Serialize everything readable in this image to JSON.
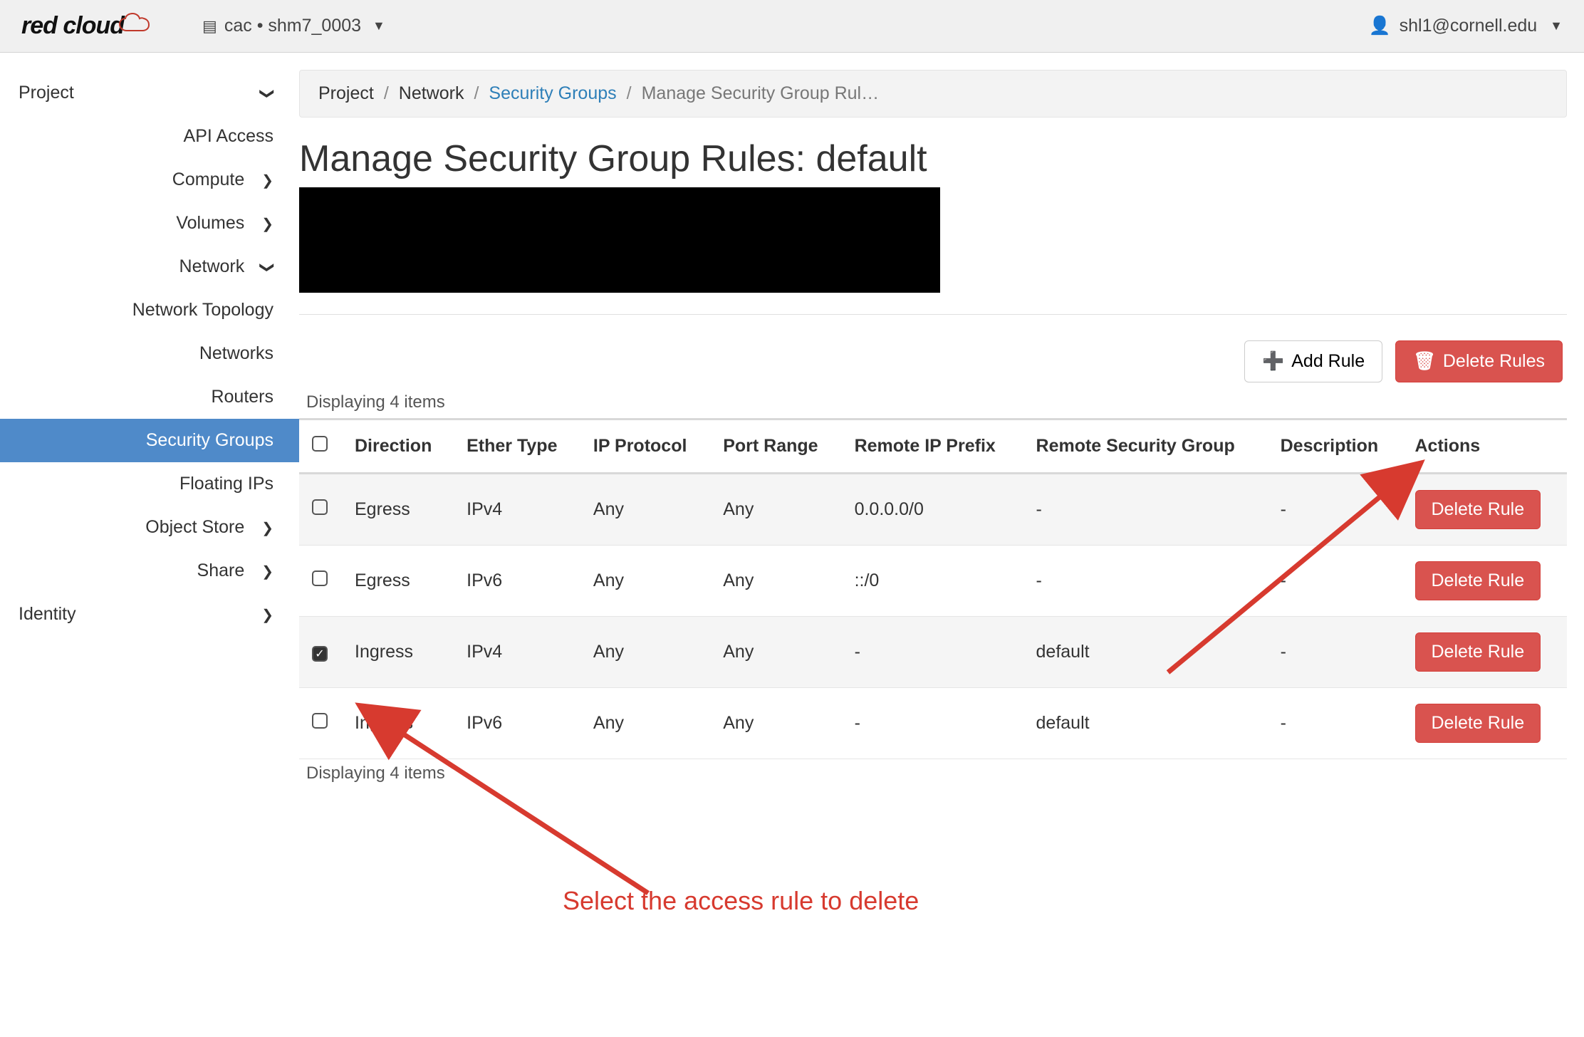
{
  "topbar": {
    "logo_left": "red",
    "logo_right": "cloud",
    "project_switcher": "cac • shm7_0003",
    "user": "shl1@cornell.edu"
  },
  "sidebar": {
    "project": "Project",
    "api_access": "API Access",
    "compute": "Compute",
    "volumes": "Volumes",
    "network": "Network",
    "network_topology": "Network Topology",
    "networks": "Networks",
    "routers": "Routers",
    "security_groups": "Security Groups",
    "floating_ips": "Floating IPs",
    "object_store": "Object Store",
    "share": "Share",
    "identity": "Identity"
  },
  "breadcrumb": {
    "project": "Project",
    "network": "Network",
    "security_groups": "Security Groups",
    "current": "Manage Security Group Rul…"
  },
  "page": {
    "title": "Manage Security Group Rules: default",
    "add_rule": "Add Rule",
    "delete_rules": "Delete Rules",
    "displaying_top": "Displaying 4 items",
    "displaying_bottom": "Displaying 4 items"
  },
  "table": {
    "headers": {
      "direction": "Direction",
      "ether_type": "Ether Type",
      "ip_protocol": "IP Protocol",
      "port_range": "Port Range",
      "remote_ip_prefix": "Remote IP Prefix",
      "remote_sg": "Remote Security Group",
      "description": "Description",
      "actions": "Actions"
    },
    "delete_rule": "Delete Rule",
    "rows": [
      {
        "checked": false,
        "direction": "Egress",
        "ether": "IPv4",
        "proto": "Any",
        "port": "Any",
        "prefix": "0.0.0.0/0",
        "rsg": "-",
        "desc": "-"
      },
      {
        "checked": false,
        "direction": "Egress",
        "ether": "IPv6",
        "proto": "Any",
        "port": "Any",
        "prefix": "::/0",
        "rsg": "-",
        "desc": "-"
      },
      {
        "checked": true,
        "direction": "Ingress",
        "ether": "IPv4",
        "proto": "Any",
        "port": "Any",
        "prefix": "-",
        "rsg": "default",
        "desc": "-"
      },
      {
        "checked": false,
        "direction": "Ingress",
        "ether": "IPv6",
        "proto": "Any",
        "port": "Any",
        "prefix": "-",
        "rsg": "default",
        "desc": "-"
      }
    ]
  },
  "annotation": {
    "label": "Select the access rule to delete"
  }
}
